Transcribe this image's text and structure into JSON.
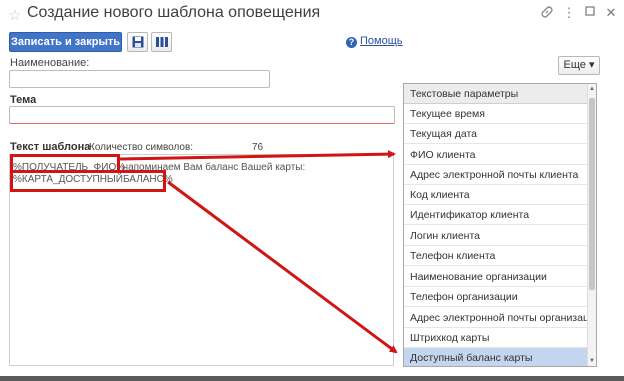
{
  "window": {
    "title": "Создание нового шаблона оповещения",
    "star_icon": "star-icon",
    "link_icon": "link-icon",
    "menu_icon": "more-vertical-icon",
    "maximize_icon": "maximize-icon",
    "close_icon": "close-icon"
  },
  "toolbar": {
    "save_close_label": "Записать и закрыть",
    "save_icon": "floppy-disk-icon",
    "grid_icon": "table-columns-icon",
    "help_label": "Помощь",
    "help_icon": "?"
  },
  "form": {
    "name_label": "Наименование:",
    "name_value": "",
    "subject_label": "Тема",
    "subject_value": "",
    "template_label": "Текст шаблона",
    "char_count_label": "Количество символов:",
    "char_count_value": "76",
    "template_line1_a": "%ПОЛУЧАТЕЛЬ_ФИО%",
    "template_line1_b": ", напоминаем Вам баланс Вашей карты:",
    "template_line2": "%КАРТА_ДОСТУПНЫЙБАЛАНС%"
  },
  "more_button": {
    "label": "Еще",
    "arrow": "▾"
  },
  "params_list": {
    "header": "Текстовые параметры",
    "items": [
      "Текущее время",
      "Текущая дата",
      "ФИО клиента",
      "Адрес электронной почты клиента",
      "Код клиента",
      "Идентификатор клиента",
      "Логин клиента",
      "Телефон клиента",
      "Наименование организации",
      "Телефон организации",
      "Адрес электронной почты организации",
      "Штрихкод карты",
      "Доступный баланс карты"
    ],
    "selected_item": "Доступный баланс карты"
  },
  "colors": {
    "primary": "#4274c8",
    "highlight_red": "#d21414",
    "selection": "#c4d6ef"
  }
}
